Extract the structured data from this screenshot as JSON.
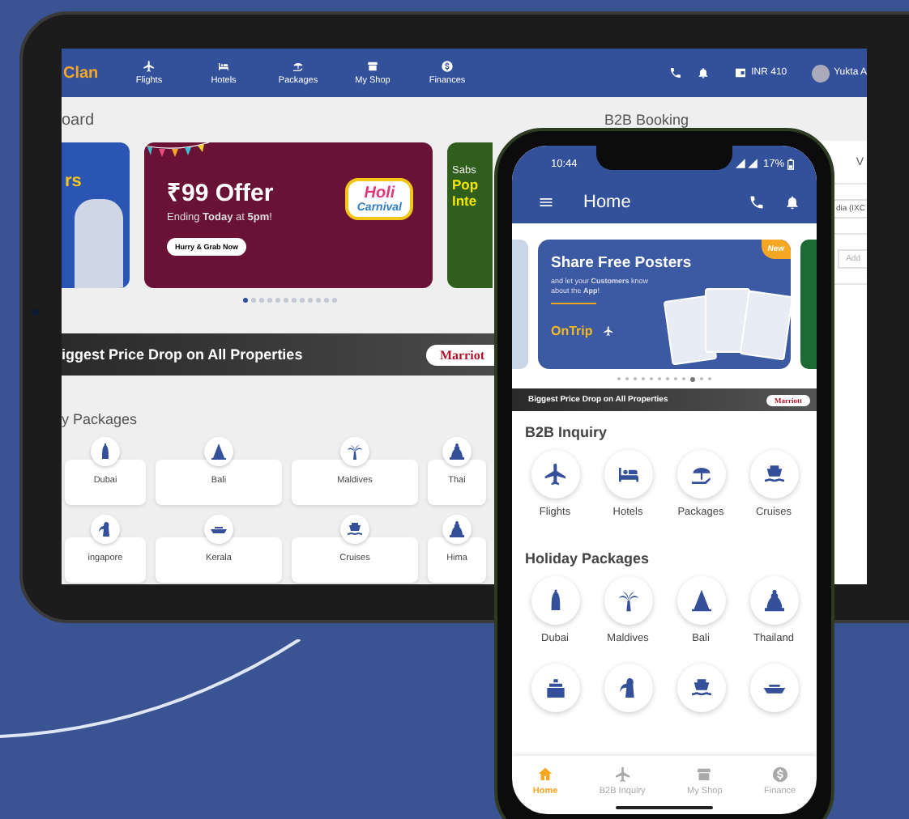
{
  "tablet": {
    "logo": "Clan",
    "nav": [
      {
        "label": "Flights"
      },
      {
        "label": "Hotels"
      },
      {
        "label": "Packages"
      },
      {
        "label": "My Shop"
      },
      {
        "label": "Finances"
      }
    ],
    "wallet": "INR 410",
    "user": "Yukta A",
    "heading": "oard",
    "left_banner": {
      "title": "rs"
    },
    "offer_banner": {
      "title": "₹99 **Offer**",
      "subtitle": "Ending **Today** at **5pm**!",
      "button": "Hurry & Grab Now",
      "badge_top": "Holi",
      "badge_bottom": "Carnival"
    },
    "right_banner": {
      "line_1": "Sabs",
      "line_2": "Pop",
      "line_3": "Inte"
    },
    "dots": [
      {
        "selected": true
      },
      {
        "selected": false
      },
      {
        "selected": false
      },
      {
        "selected": false
      },
      {
        "selected": false
      },
      {
        "selected": false
      },
      {
        "selected": false
      },
      {
        "selected": false
      },
      {
        "selected": false
      },
      {
        "selected": false
      },
      {
        "selected": false
      },
      {
        "selected": false
      }
    ],
    "promo_strip": {
      "text": "iggest Price Drop on All Properties",
      "brand": "Marriot"
    },
    "packages_heading": "y Packages",
    "packages": [
      {
        "label": "Dubai"
      },
      {
        "label": "Bali"
      },
      {
        "label": "Maldives"
      },
      {
        "label": "Thai"
      },
      {
        "label": "ingapore"
      },
      {
        "label": "Kerala"
      },
      {
        "label": "Cruises"
      },
      {
        "label": "Hima"
      }
    ],
    "side_panel": {
      "title": "B2B Booking",
      "tab": "V",
      "field_value": "dia (IXC",
      "placeholder": "Add"
    }
  },
  "phone": {
    "time": "10:44",
    "battery": "17%",
    "title": "Home",
    "banner": {
      "title": "Share Free Posters",
      "subtitle": "and let your **Customers** know about the **App**!",
      "badge": "New",
      "logo": "OnTrip"
    },
    "dots": [
      {
        "selected": false
      },
      {
        "selected": false
      },
      {
        "selected": false
      },
      {
        "selected": false
      },
      {
        "selected": false
      },
      {
        "selected": false
      },
      {
        "selected": false
      },
      {
        "selected": false
      },
      {
        "selected": false
      },
      {
        "selected": true
      },
      {
        "selected": false
      },
      {
        "selected": false
      }
    ],
    "promo_strip": {
      "text": "Biggest Price Drop on All Properties",
      "brand": "Marriott"
    },
    "b2b_heading": "B2B Inquiry",
    "b2b_items": [
      {
        "label": "Flights"
      },
      {
        "label": "Hotels"
      },
      {
        "label": "Packages"
      },
      {
        "label": "Cruises"
      }
    ],
    "holiday_heading": "Holiday Packages",
    "holiday_items": [
      {
        "label": "Dubai"
      },
      {
        "label": "Maldives"
      },
      {
        "label": "Bali"
      },
      {
        "label": "Thailand"
      }
    ],
    "bottom_nav": [
      {
        "label": "Home",
        "selected": true
      },
      {
        "label": "B2B Inquiry",
        "selected": false
      },
      {
        "label": "My Shop",
        "selected": false
      },
      {
        "label": "Finance",
        "selected": false
      }
    ]
  }
}
